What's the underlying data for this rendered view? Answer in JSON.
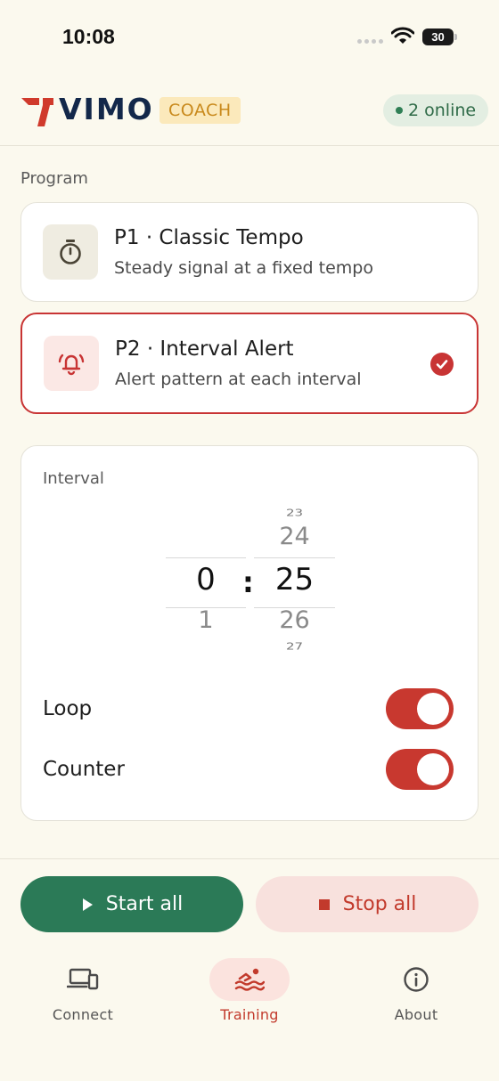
{
  "status_bar": {
    "time": "10:08",
    "battery": "30"
  },
  "header": {
    "logo_text": "VIMO",
    "badge": "COACH",
    "online_text": "2 online",
    "colors": {
      "brand": "#13284a",
      "logo_mark": "#d03a2c",
      "online": "#2f7f55"
    }
  },
  "program": {
    "section_label": "Program",
    "items": [
      {
        "title": "P1 · Classic Tempo",
        "subtitle": "Steady signal at a fixed tempo",
        "icon": "stopwatch-icon",
        "selected": false
      },
      {
        "title": "P2 · Interval Alert",
        "subtitle": "Alert pattern at each interval",
        "icon": "bell-ringing-icon",
        "selected": true
      }
    ]
  },
  "interval": {
    "label": "Interval",
    "minutes": {
      "selected": "0",
      "next": "1"
    },
    "seconds": {
      "prev2": "23",
      "prev1": "24",
      "selected": "25",
      "next1": "26",
      "next2": "27"
    },
    "separator": ":"
  },
  "toggles": [
    {
      "label": "Loop",
      "on": true
    },
    {
      "label": "Counter",
      "on": true
    }
  ],
  "actions": {
    "start_label": "Start all",
    "stop_label": "Stop all",
    "colors": {
      "start": "#2b7a57",
      "stop_bg": "#f8e1dd",
      "stop_text": "#c23a2c"
    }
  },
  "nav": {
    "items": [
      {
        "label": "Connect",
        "icon": "devices-icon",
        "active": false
      },
      {
        "label": "Training",
        "icon": "swimming-icon",
        "active": true
      },
      {
        "label": "About",
        "icon": "info-icon",
        "active": false
      }
    ]
  }
}
